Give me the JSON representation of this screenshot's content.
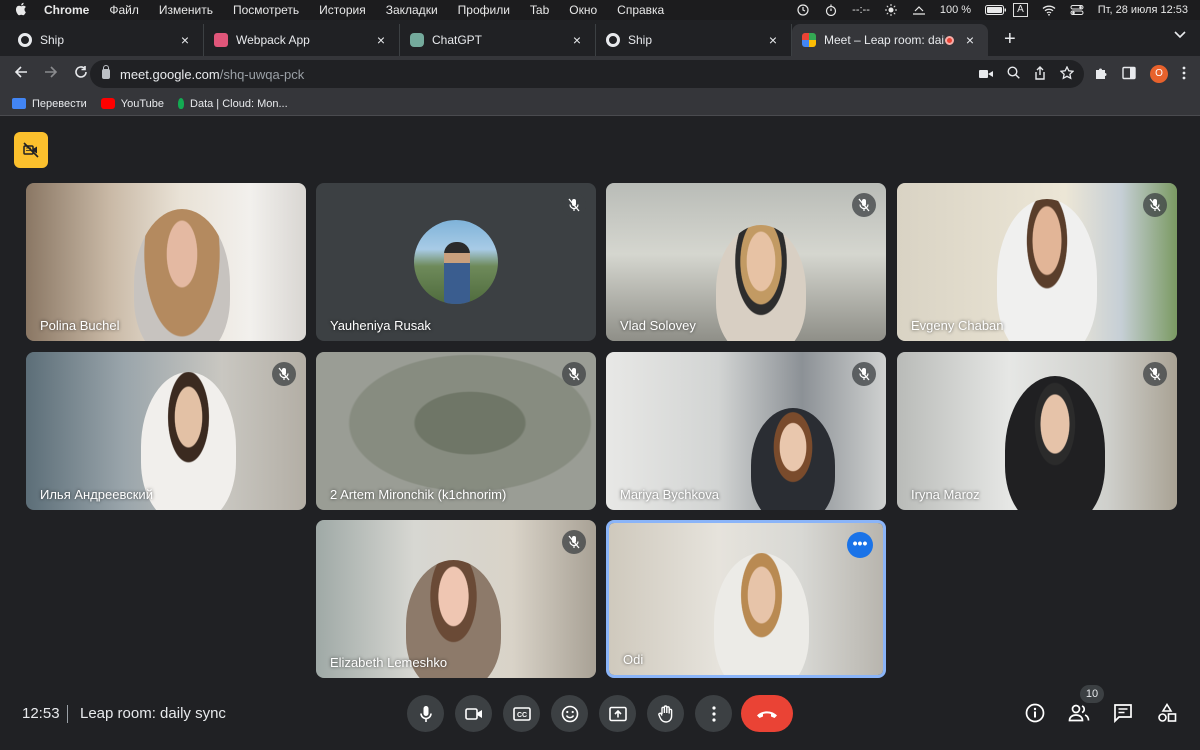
{
  "menubar": {
    "app": "Chrome",
    "items": [
      "Файл",
      "Изменить",
      "Посмотреть",
      "История",
      "Закладки",
      "Профили",
      "Tab",
      "Окно",
      "Справка"
    ],
    "timer": "--:--",
    "battery": "100 %",
    "input_source": "A",
    "datetime": "Пт, 28 июля  12:53"
  },
  "tabs": [
    {
      "title": "Ship",
      "favicon_color": "#e8eaed"
    },
    {
      "title": "Webpack App",
      "favicon_color": "#e0567a"
    },
    {
      "title": "ChatGPT",
      "favicon_color": "#74aa9c"
    },
    {
      "title": "Ship",
      "favicon_color": "#e8eaed"
    },
    {
      "title": "Meet – Leap room: daily sy",
      "favicon_color": "#34a853"
    }
  ],
  "address": {
    "domain": "meet.google.com",
    "path": "/shq-uwqa-pck",
    "profile_initial": "O"
  },
  "bookmarks": [
    {
      "label": "Перевести",
      "color": "#4285f4"
    },
    {
      "label": "YouTube",
      "color": "#ff0000"
    },
    {
      "label": "Data | Cloud: Mon...",
      "color": "#13aa52"
    }
  ],
  "participants": [
    {
      "name": "Polina Buchel",
      "muted": false
    },
    {
      "name": "Yauheniya Rusak",
      "muted": true
    },
    {
      "name": "Vlad Solovey",
      "muted": true
    },
    {
      "name": "Evgeny Chaban",
      "muted": true
    },
    {
      "name": "Илья Андреевский",
      "muted": true
    },
    {
      "name": "2 Artem Mironchik (k1chnorim)",
      "muted": true
    },
    {
      "name": "Mariya Bychkova",
      "muted": true
    },
    {
      "name": "Iryna Maroz",
      "muted": true
    },
    {
      "name": "Elizabeth Lemeshko",
      "muted": true
    },
    {
      "name": "Odi",
      "muted": false
    }
  ],
  "bottom": {
    "time": "12:53",
    "meeting_title": "Leap room: daily sync",
    "participant_count": "10"
  },
  "colors": {
    "accent": "#8ab4f8",
    "end_call": "#ea4335",
    "highlight": "#fbc02d"
  },
  "icons": [
    "apple-icon",
    "mic-icon",
    "camera-icon",
    "captions-icon",
    "emoji-icon",
    "present-icon",
    "raise-hand-icon",
    "more-options-icon",
    "end-call-icon",
    "info-icon",
    "people-icon",
    "chat-icon",
    "activities-icon",
    "mic-off-icon",
    "camera-off-icon"
  ]
}
